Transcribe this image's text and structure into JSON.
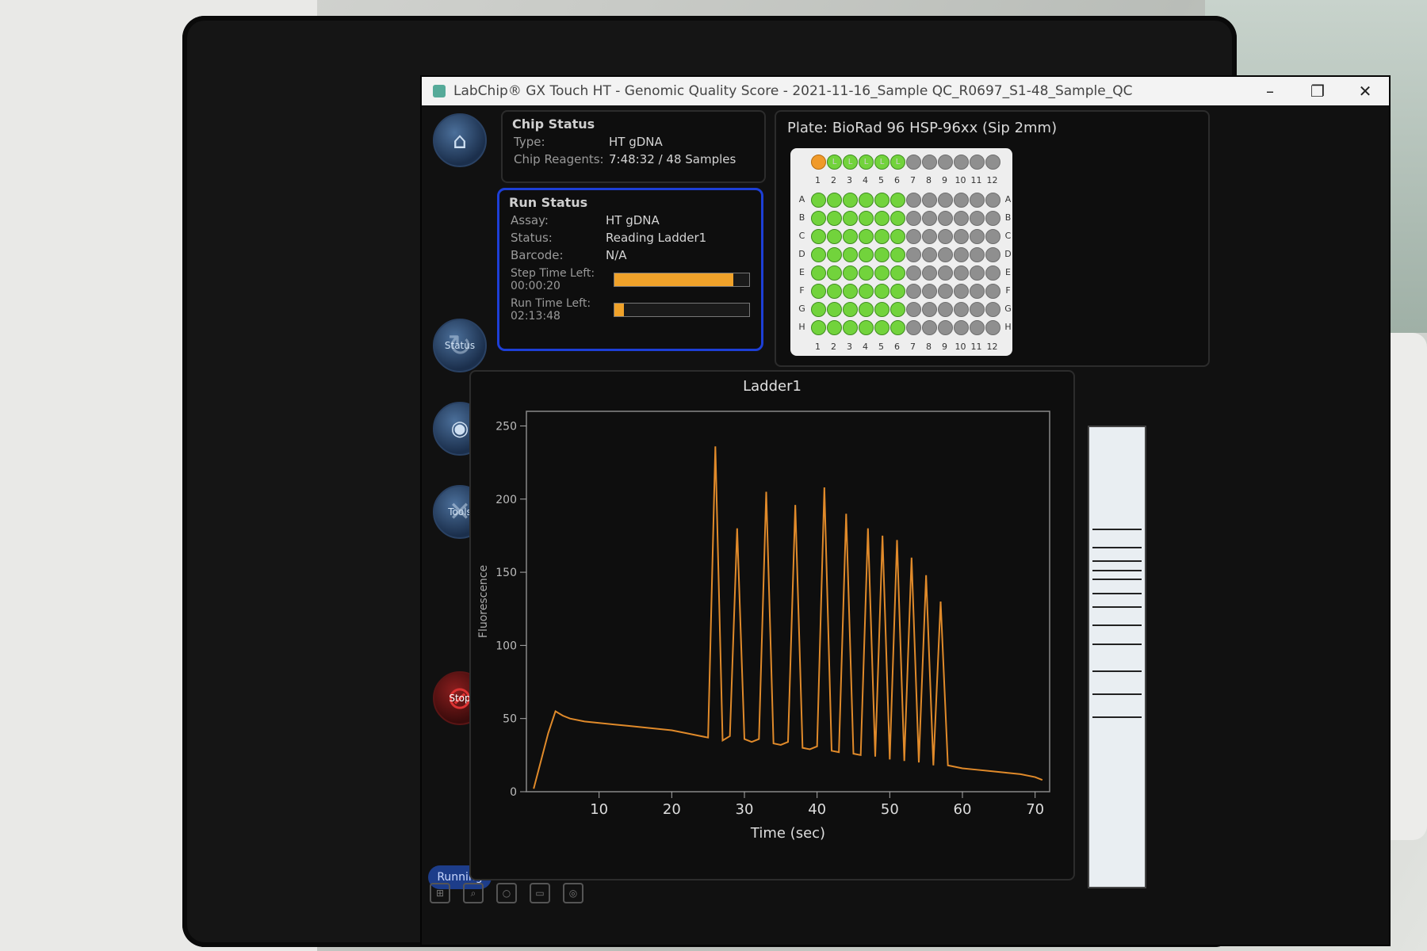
{
  "window": {
    "title": "LabChip® GX Touch HT - Genomic Quality Score - 2021-11-16_Sample QC_R0697_S1-48_Sample_QC",
    "minimize_icon": "minimize-icon",
    "restore_icon": "restore-icon",
    "close_icon": "close-icon"
  },
  "sidebar": {
    "home_icon": "home-icon",
    "status_label": "Status",
    "review_icon": "eye-icon",
    "tools_label": "Tools",
    "stop_label": "Stop",
    "running_label": "Running"
  },
  "chip_status": {
    "heading": "Chip Status",
    "type_label": "Type:",
    "type_value": "HT gDNA",
    "reagents_label": "Chip Reagents:",
    "reagents_value": "7:48:32 / 48 Samples"
  },
  "run_status": {
    "heading": "Run Status",
    "assay_label": "Assay:",
    "assay_value": "HT gDNA",
    "status_label": "Status:",
    "status_value": "Reading Ladder1",
    "barcode_label": "Barcode:",
    "barcode_value": "N/A",
    "step_label": "Step Time Left:",
    "step_value": "00:00:20",
    "step_progress": 0.88,
    "run_label": "Run Time Left:",
    "run_value": "02:13:48",
    "run_progress": 0.07
  },
  "plate": {
    "label": "Plate:",
    "name": "BioRad 96 HSP-96xx",
    "sip": "(Sip 2mm)",
    "rows": [
      "A",
      "B",
      "C",
      "D",
      "E",
      "F",
      "G",
      "H"
    ],
    "columns": [
      "1",
      "2",
      "3",
      "4",
      "5",
      "6",
      "7",
      "8",
      "9",
      "10",
      "11",
      "12"
    ],
    "ladder_wells": [
      "orange",
      "L",
      "L",
      "L",
      "L",
      "L",
      "gray",
      "gray",
      "gray",
      "gray",
      "gray",
      "gray"
    ],
    "done_columns": 6,
    "done_color": "#72d33c",
    "active_color": "#f09a2a",
    "idle_color": "#8f8f8f"
  },
  "chart_data": {
    "type": "line",
    "title": "Ladder1",
    "xlabel": "Time (sec)",
    "ylabel": "Fluorescence",
    "xlim": [
      0,
      72
    ],
    "ylim": [
      0,
      260
    ],
    "xticks": [
      10,
      20,
      30,
      40,
      50,
      60,
      70
    ],
    "yticks": [
      0,
      50,
      100,
      150,
      200,
      250
    ],
    "color": "#e08a2a",
    "series": [
      {
        "x": [
          1,
          3,
          4,
          5,
          6,
          8,
          10,
          12,
          14,
          16,
          18,
          20,
          22,
          24,
          25,
          26,
          27,
          28,
          29,
          30,
          31,
          32,
          33,
          34,
          35,
          36,
          37,
          38,
          39,
          40,
          41,
          42,
          43,
          44,
          45,
          46,
          47,
          48,
          49,
          50,
          51,
          52,
          53,
          54,
          55,
          56,
          57,
          58,
          60,
          62,
          64,
          66,
          68,
          70,
          71
        ],
        "y": [
          2,
          40,
          55,
          52,
          50,
          48,
          47,
          46,
          45,
          44,
          43,
          42,
          40,
          38,
          37,
          236,
          35,
          38,
          180,
          36,
          34,
          36,
          205,
          33,
          32,
          34,
          196,
          30,
          29,
          31,
          208,
          28,
          27,
          190,
          26,
          25,
          180,
          24,
          175,
          22,
          172,
          21,
          160,
          20,
          148,
          18,
          130,
          18,
          16,
          15,
          14,
          13,
          12,
          10,
          8
        ]
      }
    ]
  },
  "gel": {
    "bands": [
      0.22,
      0.26,
      0.29,
      0.31,
      0.33,
      0.36,
      0.39,
      0.43,
      0.47,
      0.53,
      0.58,
      0.63
    ]
  },
  "taskbar": {
    "icons": [
      "windows-icon",
      "search-icon",
      "taskview-icon",
      "folder-icon",
      "app-icon"
    ]
  }
}
